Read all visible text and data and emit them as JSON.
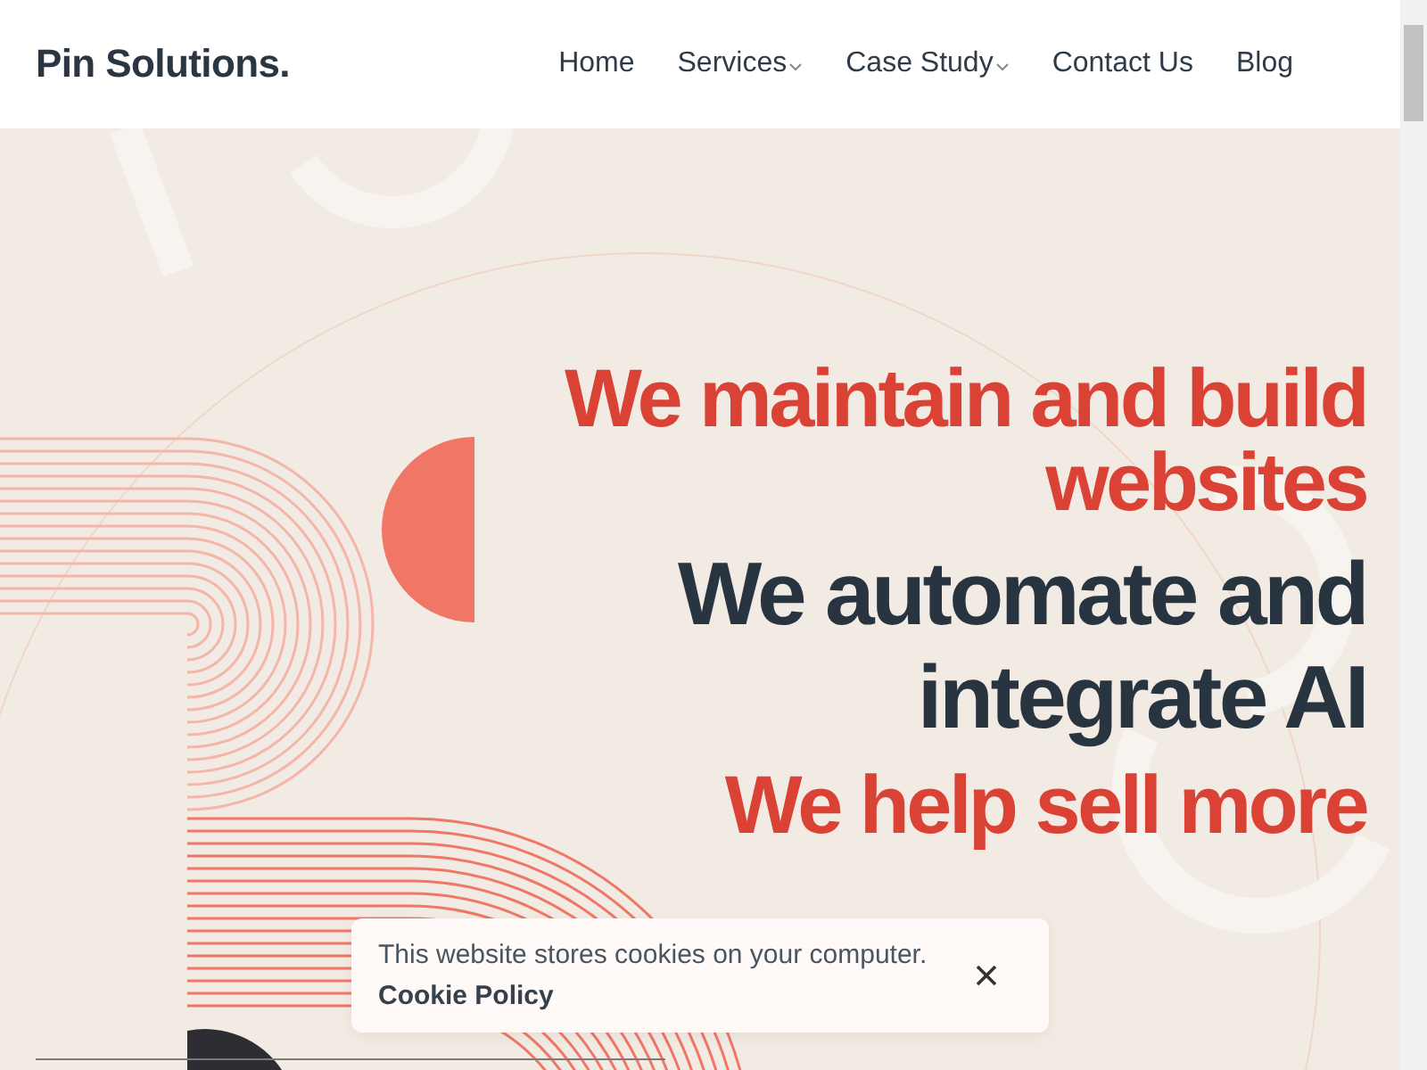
{
  "brand": "Pin Solutions.",
  "nav": [
    {
      "label": "Home",
      "has_dropdown": false
    },
    {
      "label": "Services",
      "has_dropdown": true
    },
    {
      "label": "Case Study",
      "has_dropdown": true
    },
    {
      "label": "Contact Us",
      "has_dropdown": false
    },
    {
      "label": "Blog",
      "has_dropdown": false
    }
  ],
  "headlines": [
    {
      "text": "We maintain and build websites",
      "kind": "accent"
    },
    {
      "text": "We automate and integrate AI",
      "kind": "dark"
    },
    {
      "text": "We help sell more",
      "kind": "accent"
    }
  ],
  "cookie_banner": {
    "message": "This website stores cookies on your computer.",
    "link": "Cookie Policy"
  }
}
